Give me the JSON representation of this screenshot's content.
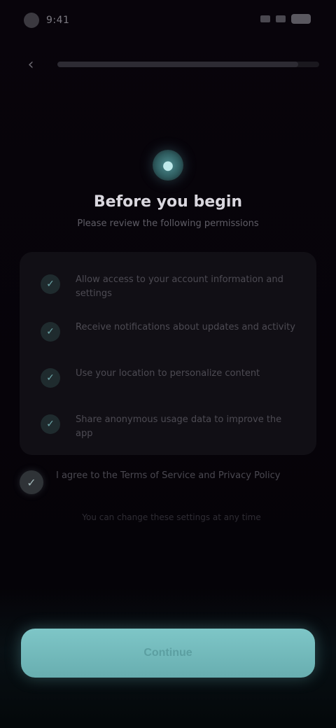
{
  "status_bar": {
    "time": "9:41"
  },
  "top_bar": {
    "progress": 0.92
  },
  "hero": {
    "title": "Before you begin",
    "subtitle": "Please review the following permissions"
  },
  "permissions": [
    {
      "icon": "check-circle-icon",
      "text": "Allow access to your account information and settings"
    },
    {
      "icon": "check-circle-icon",
      "text": "Receive notifications about updates and activity"
    },
    {
      "icon": "check-circle-icon",
      "text": "Use your location to personalize content"
    },
    {
      "icon": "check-circle-icon",
      "text": "Share anonymous usage data to improve the app"
    }
  ],
  "consent": {
    "text": "I agree to the Terms of Service and Privacy Policy"
  },
  "legal_note": "You can change these settings at any time",
  "primary_button": {
    "label": "Continue"
  },
  "colors": {
    "accent": "#7ec6c7",
    "background": "#060309",
    "card": "#110f15"
  }
}
